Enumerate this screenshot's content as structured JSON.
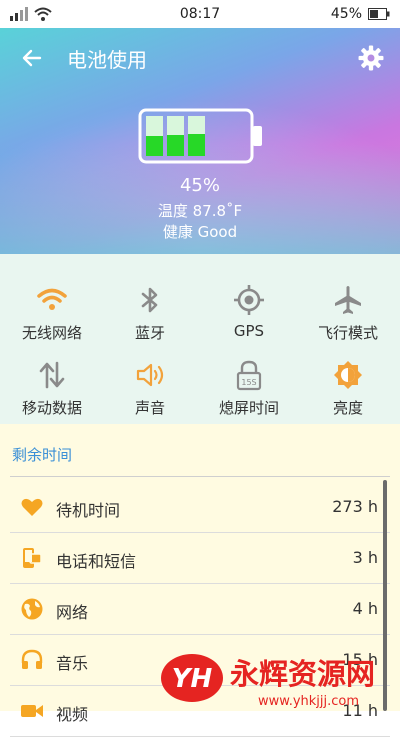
{
  "status_bar": {
    "time": "08:17",
    "battery": "45%"
  },
  "header": {
    "title": "电池使用"
  },
  "battery": {
    "percent": "45%",
    "temperature": "温度 87.8˚F",
    "health": "健康 Good",
    "level": 0.45
  },
  "toggles": [
    {
      "label": "无线网络",
      "icon": "wifi-icon"
    },
    {
      "label": "蓝牙",
      "icon": "bluetooth-icon"
    },
    {
      "label": "GPS",
      "icon": "gps-icon"
    },
    {
      "label": "飞行模式",
      "icon": "airplane-icon"
    },
    {
      "label": "移动数据",
      "icon": "mobile-data-icon"
    },
    {
      "label": "声音",
      "icon": "speaker-icon"
    },
    {
      "label": "熄屏时间",
      "icon": "lock-timeout-icon",
      "icon_text": "15S"
    },
    {
      "label": "亮度",
      "icon": "brightness-icon"
    }
  ],
  "remaining": {
    "heading": "剩余时间",
    "items": [
      {
        "label": "待机时间",
        "value": "273 h",
        "icon": "heart-icon"
      },
      {
        "label": "电话和短信",
        "value": "3 h",
        "icon": "phone-sms-icon"
      },
      {
        "label": "网络",
        "value": "4 h",
        "icon": "globe-icon"
      },
      {
        "label": "音乐",
        "value": "15 h",
        "icon": "headphones-icon"
      },
      {
        "label": "视频",
        "value": "11 h",
        "icon": "video-icon"
      }
    ]
  },
  "watermark": {
    "brand": "永辉资源网",
    "url": "www.yhkjjj.com",
    "logo": "YH"
  },
  "colors": {
    "accent_orange": "#f5a623",
    "toggle_bg": "#e9f6f0",
    "list_bg": "#fffbe1",
    "heading_blue": "#3a8fd6"
  }
}
